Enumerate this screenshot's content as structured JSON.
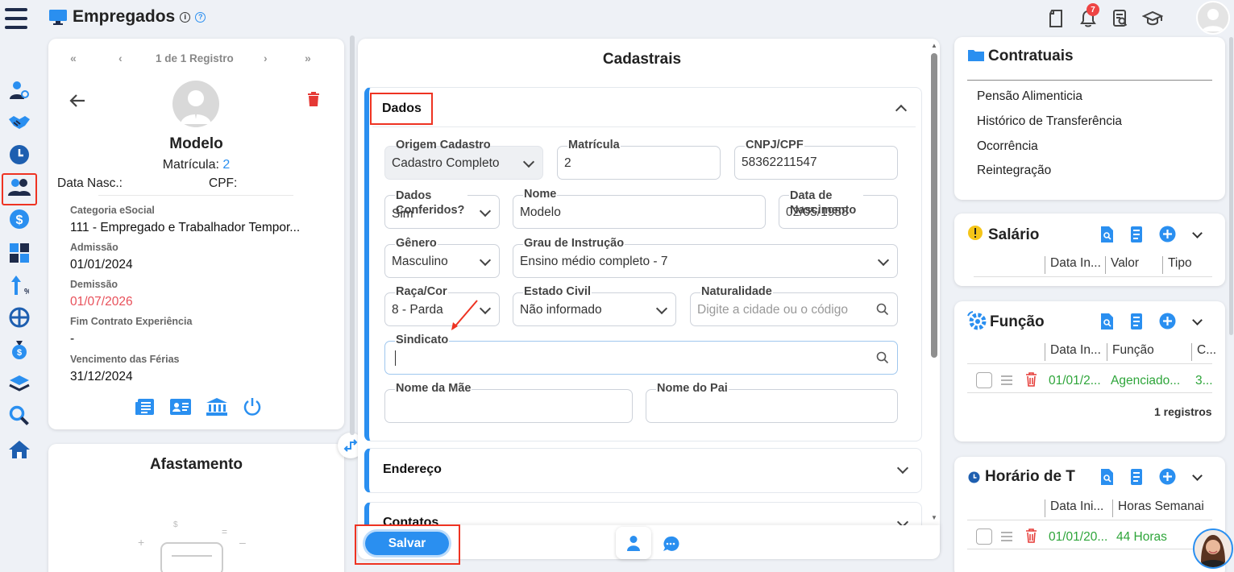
{
  "header": {
    "title": "Empregados",
    "info_icon": "i",
    "help_icon": "?",
    "notifications_count": "7"
  },
  "profile": {
    "pager": {
      "first": "«",
      "prev": "‹",
      "record": "1 de 1 Registro",
      "next": "›",
      "last": "»"
    },
    "name": "Modelo",
    "matricula_label": "Matrícula:",
    "matricula_value": "2",
    "birth_label": "Data Nasc.:",
    "cpf_label": "CPF:",
    "fields": [
      {
        "label": "Categoria eSocial",
        "value": "111 - Empregado e Trabalhador Tempor..."
      },
      {
        "label": "Admissão",
        "value": "01/01/2024"
      },
      {
        "label": "Demissão",
        "value": "01/07/2026"
      },
      {
        "label": "Fim Contrato Experiência",
        "value": "-"
      },
      {
        "label": "Vencimento das Férias",
        "value": "31/12/2024"
      }
    ]
  },
  "afastamento": {
    "title": "Afastamento"
  },
  "center": {
    "title": "Cadastrais",
    "section_dados": "Dados",
    "section_endereco": "Endereço",
    "section_contatos": "Contatos",
    "save_label": "Salvar",
    "fields": {
      "origem": {
        "label": "Origem Cadastro",
        "value": "Cadastro Completo"
      },
      "matricula": {
        "label": "Matrícula",
        "value": "2"
      },
      "cnpj": {
        "label": "CNPJ/CPF",
        "value": "58362211547"
      },
      "dados_conf": {
        "label": "Dados Conferidos?",
        "value": "Sim"
      },
      "nome": {
        "label": "Nome",
        "value": "Modelo"
      },
      "nascimento": {
        "label": "Data de Nascimento",
        "value": "02/05/1958"
      },
      "genero": {
        "label": "Gênero",
        "value": "Masculino"
      },
      "grau": {
        "label": "Grau de Instrução",
        "value": "Ensino médio completo - 7"
      },
      "raca": {
        "label": "Raça/Cor",
        "value": "8 - Parda"
      },
      "estado_civil": {
        "label": "Estado Civil",
        "value": "Não informado"
      },
      "naturalidade": {
        "label": "Naturalidade",
        "placeholder": "Digite a cidade ou o código"
      },
      "sindicato": {
        "label": "Sindicato",
        "value": ""
      },
      "mae": {
        "label": "Nome da Mãe",
        "value": ""
      },
      "pai": {
        "label": "Nome do Pai",
        "value": ""
      }
    }
  },
  "right": {
    "contratuais": {
      "title": "Contratuais",
      "links": [
        "Pensão Alimenticia",
        "Histórico de Transferência",
        "Ocorrência",
        "Reintegração"
      ]
    },
    "salario": {
      "title": "Salário",
      "columns": [
        "Data In...",
        "Valor",
        "Tipo"
      ]
    },
    "funcao": {
      "title": "Função",
      "columns": [
        "Data In...",
        "Função",
        "C..."
      ],
      "row": {
        "date": "01/01/2...",
        "funcao": "Agenciado...",
        "c": "3..."
      },
      "footer": "1 registros"
    },
    "horario": {
      "title": "Horário de T",
      "columns": [
        "Data Ini...",
        "Horas Semanai"
      ],
      "row": {
        "date": "01/01/20...",
        "horas": "44 Horas"
      }
    }
  },
  "colors": {
    "accent": "#2a8ff0",
    "danger": "#e53935",
    "navy": "#1e2b4a",
    "green": "#2ea53a",
    "highlight_box": "#e32222"
  }
}
